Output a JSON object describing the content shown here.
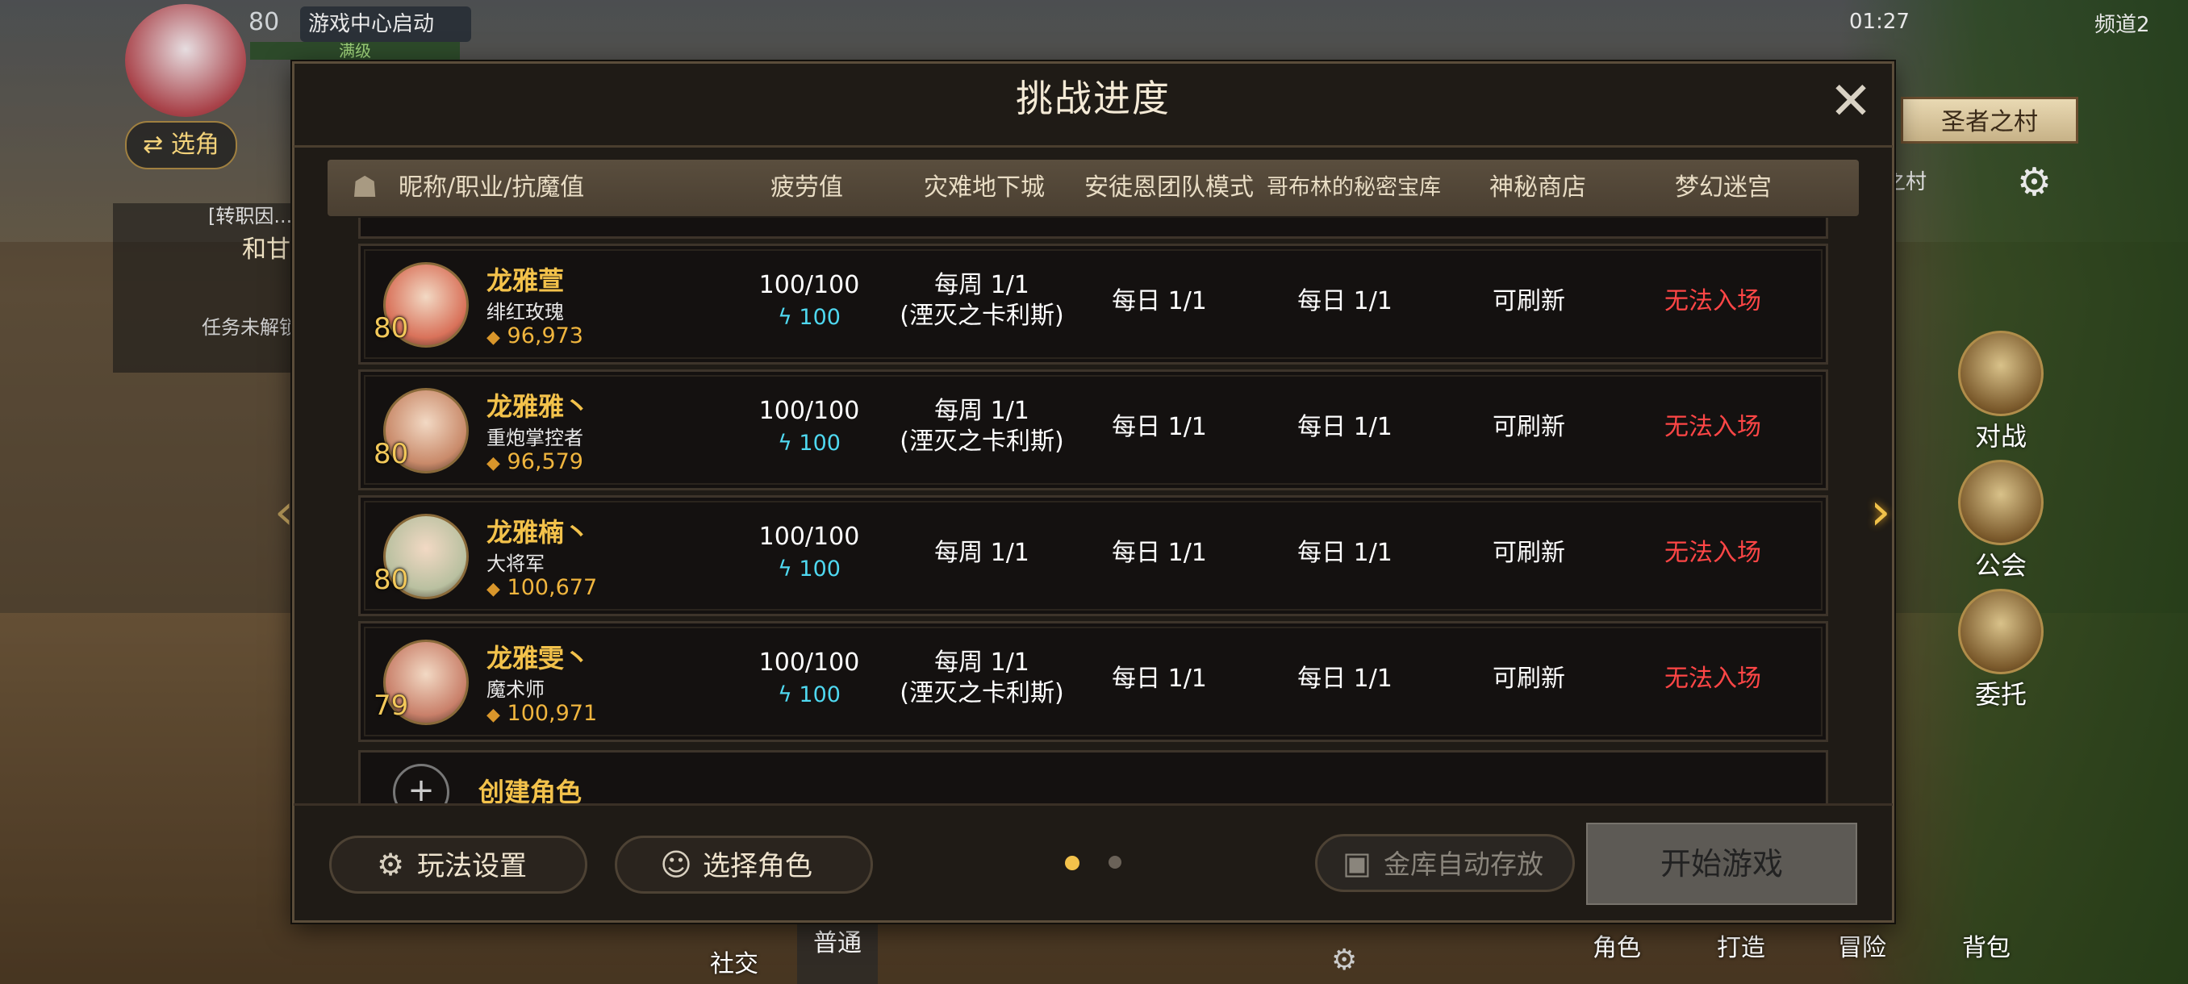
{
  "hud": {
    "level": "80",
    "game_center": "游戏中心启动",
    "full_level": "满级",
    "switch_role": "⇄ 选角",
    "quest_line1": "[转职因...",
    "quest_line2": "和甘...",
    "quest_line3": "任务未解锁",
    "time": "01:27",
    "channel": "频道2",
    "village_name": "圣者之村",
    "village_sub": "之村"
  },
  "side_buttons": [
    {
      "label": "对战"
    },
    {
      "label": "公会"
    },
    {
      "label": "委托"
    }
  ],
  "bottom_nav": {
    "social": "社交",
    "normal": "普通",
    "role": "角色",
    "craft": "打造",
    "adventure": "冒险",
    "bag": "背包"
  },
  "dialog": {
    "title": "挑战进度",
    "columns": [
      "昵称/职业/抗魔值",
      "疲劳值",
      "灾难地下城",
      "安徒恩团队模式",
      "哥布林的秘密宝库",
      "神秘商店",
      "梦幻迷宫"
    ],
    "rows": [
      {
        "level": "80",
        "name": "龙雅萱",
        "job": "绯红玫瑰",
        "power": "96,973",
        "fatigue": "100/100",
        "fatigue_sub": "100",
        "disaster": "每周 1/1",
        "disaster_sub": "(湮灭之卡利斯)",
        "anton": "每日 1/1",
        "goblin": "每日 1/1",
        "shop": "可刷新",
        "maze": "无法入场"
      },
      {
        "level": "80",
        "name": "龙雅雅丶",
        "job": "重炮掌控者",
        "power": "96,579",
        "fatigue": "100/100",
        "fatigue_sub": "100",
        "disaster": "每周 1/1",
        "disaster_sub": "(湮灭之卡利斯)",
        "anton": "每日 1/1",
        "goblin": "每日 1/1",
        "shop": "可刷新",
        "maze": "无法入场"
      },
      {
        "level": "80",
        "name": "龙雅楠丶",
        "job": "大将军",
        "power": "100,677",
        "fatigue": "100/100",
        "fatigue_sub": "100",
        "disaster": "每周 1/1",
        "disaster_sub": "",
        "anton": "每日 1/1",
        "goblin": "每日 1/1",
        "shop": "可刷新",
        "maze": "无法入场"
      },
      {
        "level": "79",
        "name": "龙雅雯丶",
        "job": "魔术师",
        "power": "100,971",
        "fatigue": "100/100",
        "fatigue_sub": "100",
        "disaster": "每周 1/1",
        "disaster_sub": "(湮灭之卡利斯)",
        "anton": "每日 1/1",
        "goblin": "每日 1/1",
        "shop": "可刷新",
        "maze": "无法入场"
      }
    ],
    "create_role": "创建角色",
    "settings_btn": "玩法设置",
    "select_role_btn": "选择角色",
    "vault_btn": "金库自动存放",
    "start_btn": "开始游戏",
    "page_count": 2,
    "current_page": 1
  },
  "colors": {
    "accent_gold": "#f3c24b",
    "fatigue_cyan": "#4fd8f0",
    "status_red": "#ff4646"
  }
}
